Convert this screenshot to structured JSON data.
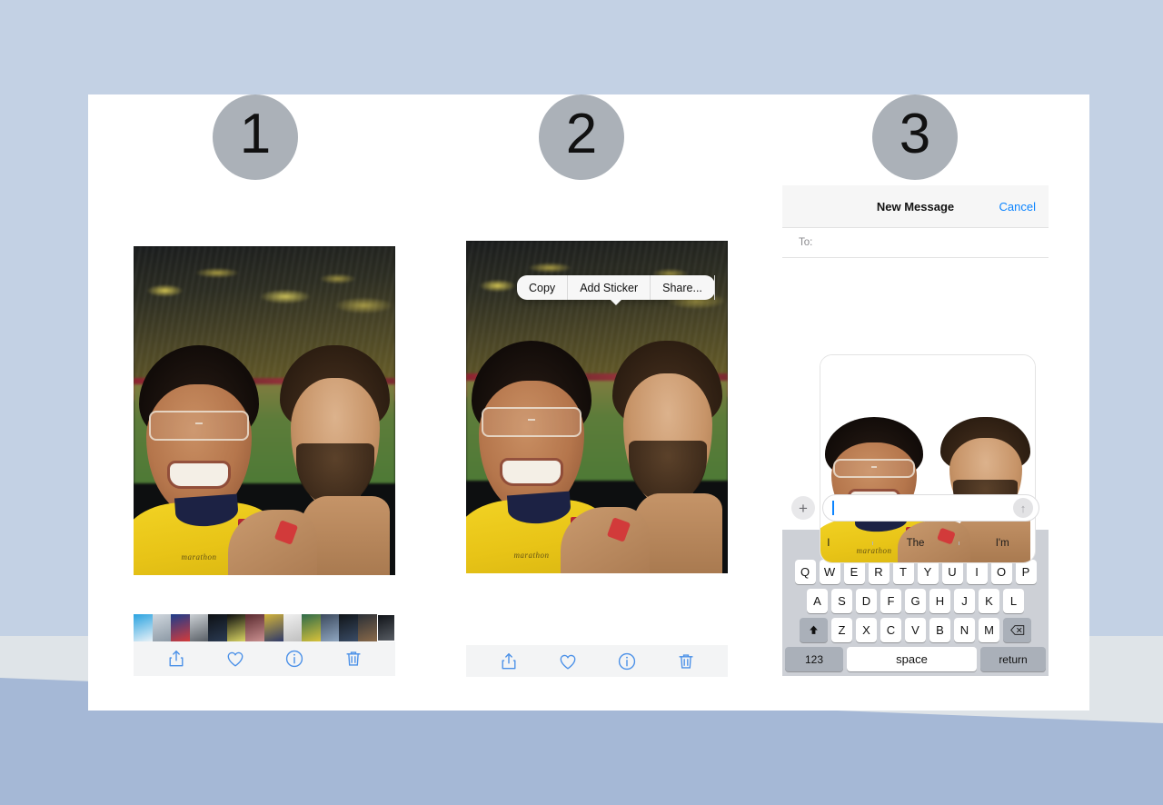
{
  "background": {
    "top_color": "#c3d1e4",
    "band_color": "#dfe4e8",
    "wedge_color": "#a5b8d6"
  },
  "card": {
    "background": "#ffffff"
  },
  "steps": [
    {
      "number": "1",
      "name": "step-badge-1"
    },
    {
      "number": "2",
      "name": "step-badge-2"
    },
    {
      "number": "3",
      "name": "step-badge-3"
    }
  ],
  "panel1": {
    "photo_alt": "stadium-selfie-photo",
    "brand_text": "marathon",
    "toolbar": [
      {
        "icon": "share-icon",
        "label": "Share"
      },
      {
        "icon": "heart-icon",
        "label": "Favorite"
      },
      {
        "icon": "info-icon",
        "label": "Info"
      },
      {
        "icon": "trash-icon",
        "label": "Delete"
      }
    ],
    "filmstrip_count": 14
  },
  "panel2": {
    "photo_alt": "stadium-selfie-photo",
    "brand_text": "marathon",
    "context_menu": [
      {
        "label": "Copy"
      },
      {
        "label": "Add Sticker"
      },
      {
        "label": "Share..."
      }
    ],
    "toolbar": [
      {
        "icon": "share-icon",
        "label": "Share"
      },
      {
        "icon": "heart-icon",
        "label": "Favorite"
      },
      {
        "icon": "info-icon",
        "label": "Info"
      },
      {
        "icon": "trash-icon",
        "label": "Delete"
      }
    ]
  },
  "panel3": {
    "header": {
      "title": "New Message",
      "cancel_label": "Cancel",
      "cancel_color": "#0b84ff"
    },
    "recipients": {
      "label": "To:",
      "value": ""
    },
    "sticker_alt": "selfie-sticker-cutout",
    "brand_text": "marathon",
    "compose": {
      "plus_label": "+",
      "placeholder": "",
      "value": "",
      "send_label": "↑"
    },
    "keyboard": {
      "predictive": [
        "I",
        "The",
        "I'm"
      ],
      "row1": [
        "Q",
        "W",
        "E",
        "R",
        "T",
        "Y",
        "U",
        "I",
        "O",
        "P"
      ],
      "row2": [
        "A",
        "S",
        "D",
        "F",
        "G",
        "H",
        "J",
        "K",
        "L"
      ],
      "row3": [
        "Z",
        "X",
        "C",
        "V",
        "B",
        "N",
        "M"
      ],
      "shift_label": "↑",
      "backspace_label": "⌫",
      "numbers_label": "123",
      "space_label": "space",
      "return_label": "return"
    }
  }
}
